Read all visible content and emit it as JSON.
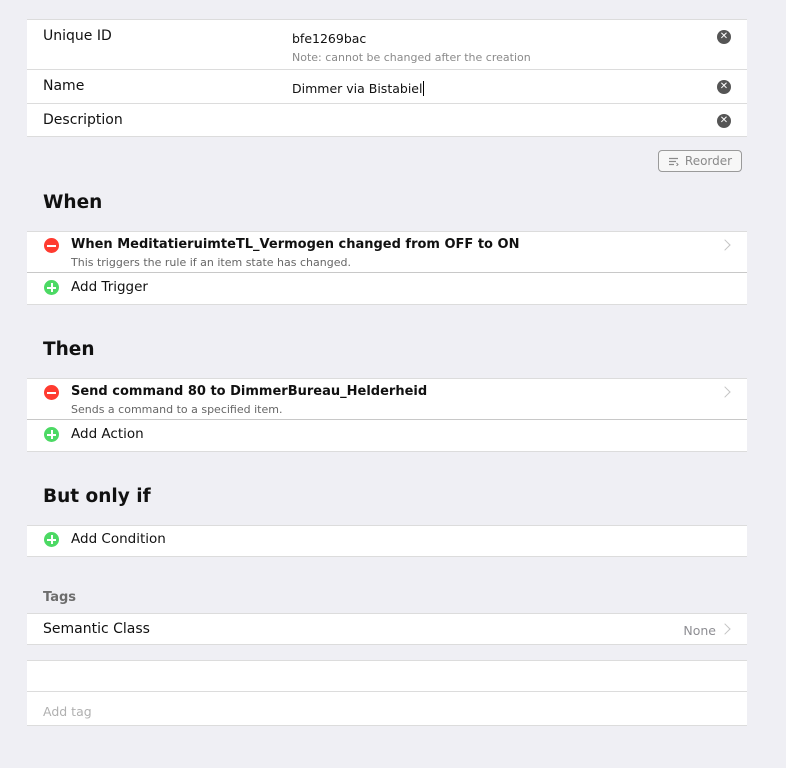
{
  "form": {
    "unique_id_label": "Unique ID",
    "unique_id_value": "bfe1269bac",
    "unique_id_note": "Note: cannot be changed after the creation",
    "name_label": "Name",
    "name_value": "Dimmer via Bistabiel",
    "description_label": "Description",
    "description_value": ""
  },
  "toolbar": {
    "reorder_label": "Reorder",
    "reorder_icon": "reorder-icon"
  },
  "when": {
    "heading": "When",
    "triggers": [
      {
        "title": "When MeditatieruimteTL_Vermogen changed from OFF to ON",
        "subtitle": "This triggers the rule if an item state has changed."
      }
    ],
    "add_label": "Add Trigger"
  },
  "then": {
    "heading": "Then",
    "actions": [
      {
        "title": "Send command 80 to DimmerBureau_Helderheid",
        "subtitle": "Sends a command to a specified item."
      }
    ],
    "add_label": "Add Action"
  },
  "but_only_if": {
    "heading": "But only if",
    "add_label": "Add Condition"
  },
  "tags": {
    "heading": "Tags",
    "semantic_class_label": "Semantic Class",
    "semantic_class_value": "None",
    "add_tag_placeholder": "Add tag"
  },
  "colors": {
    "background": "#efeff4",
    "remove": "#ff3b30",
    "add": "#4cd964",
    "clear_button": "#555555"
  }
}
